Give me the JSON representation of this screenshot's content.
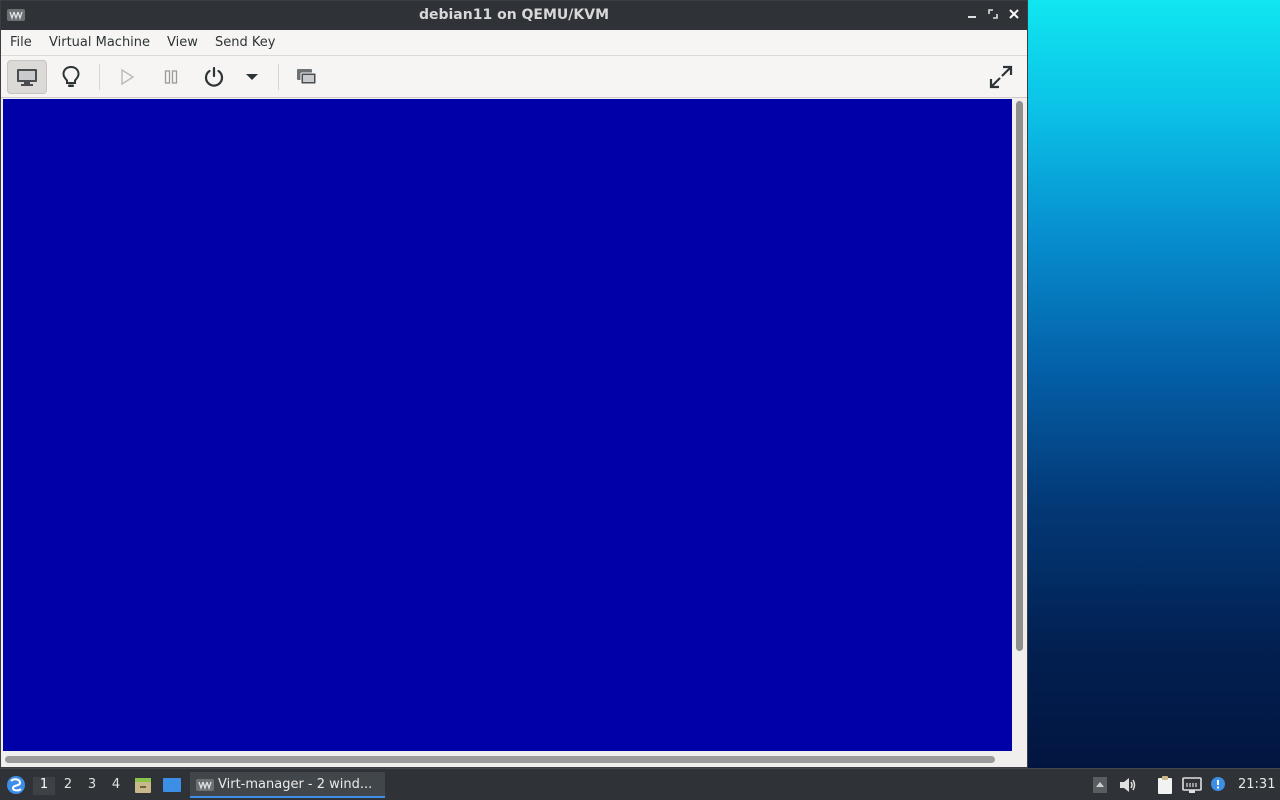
{
  "window": {
    "title": "debian11 on QEMU/KVM",
    "app_icon": "virt-manager-icon",
    "controls": [
      "minimize",
      "maximize",
      "close"
    ]
  },
  "menubar": {
    "items": [
      {
        "label": "File"
      },
      {
        "label": "Virtual Machine"
      },
      {
        "label": "View"
      },
      {
        "label": "Send Key"
      }
    ]
  },
  "toolbar": {
    "buttons": [
      {
        "icon": "monitor-icon",
        "name": "console-view",
        "active": true
      },
      {
        "icon": "lightbulb-icon",
        "name": "details-view"
      },
      {
        "icon": "play-icon",
        "name": "run",
        "disabled": true
      },
      {
        "icon": "pause-icon",
        "name": "pause",
        "disabled": true
      },
      {
        "icon": "power-icon",
        "name": "shutdown"
      },
      {
        "icon": "chevron-down-icon",
        "name": "shutdown-menu"
      },
      {
        "icon": "snapshots-icon",
        "name": "snapshots"
      },
      {
        "icon": "fullscreen-icon",
        "name": "fullscreen"
      }
    ]
  },
  "viewer": {
    "background": "#0000a8"
  },
  "taskbar": {
    "workspaces": [
      "1",
      "2",
      "3",
      "4"
    ],
    "active_workspace": "1",
    "task": {
      "label": "Virt-manager - 2 wind..."
    },
    "clock": "21:31"
  },
  "colors": {
    "titlebar": "#2f3337",
    "accent": "#3d8ee6",
    "vm_screen": "#0000a8"
  }
}
